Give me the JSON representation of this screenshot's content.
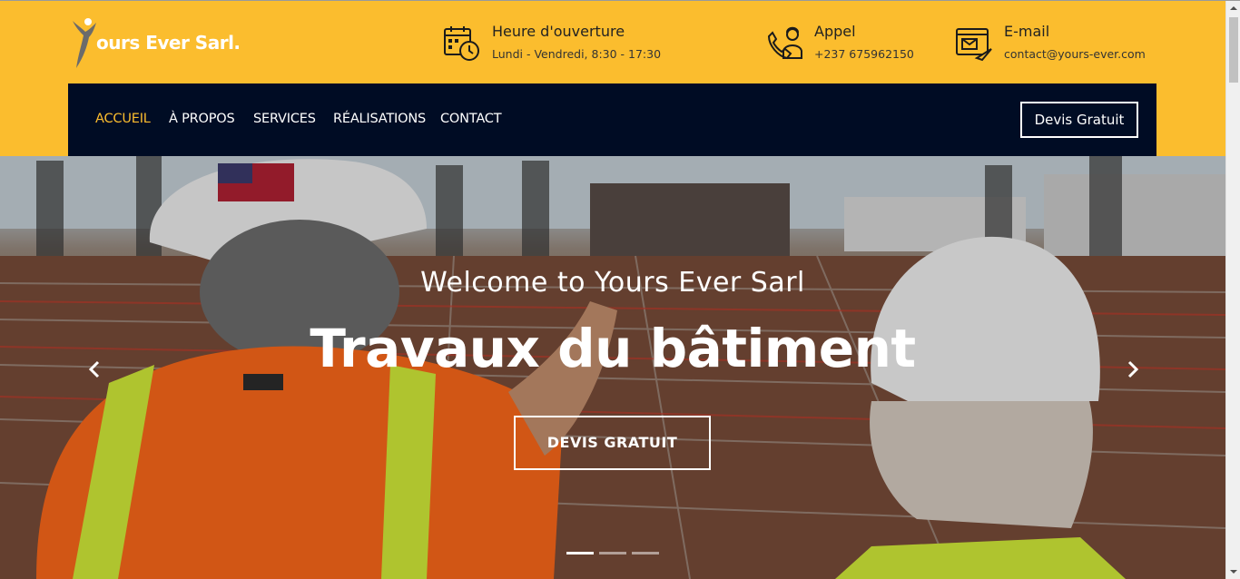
{
  "logo": {
    "text": "ours Ever Sarl.",
    "initial": "Y"
  },
  "contact_info": [
    {
      "icon": "calendar-clock-icon",
      "title": "Heure d'ouverture",
      "detail": "Lundi - Vendredi, 8:30 - 17:30"
    },
    {
      "icon": "phone-operator-icon",
      "title": "Appel",
      "detail": "+237 675962150"
    },
    {
      "icon": "email-browser-icon",
      "title": "E-mail",
      "detail": "contact@yours-ever.com"
    }
  ],
  "nav": {
    "items": [
      {
        "label": "ACCUEIL",
        "active": true
      },
      {
        "label": "À PROPOS",
        "active": false
      },
      {
        "label": "SERVICES",
        "active": false
      },
      {
        "label": "RÉALISATIONS",
        "active": false
      },
      {
        "label": "CONTACT",
        "active": false
      }
    ],
    "cta": "Devis Gratuit"
  },
  "hero": {
    "subtitle": "Welcome to Yours Ever Sarl",
    "title": "Travaux du bâtiment",
    "button": "DEVIS GRATUIT",
    "slides_count": 3,
    "active_slide": 1
  },
  "colors": {
    "accent": "#fbbd2e",
    "nav_bg": "#000c24",
    "text_white": "#ffffff"
  }
}
